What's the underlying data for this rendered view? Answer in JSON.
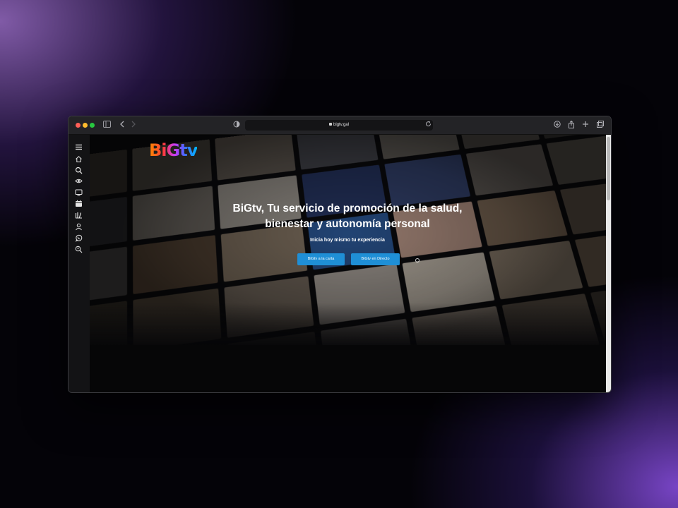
{
  "browser": {
    "url": "bigtv.gal",
    "toolbar_icons": [
      "sidebar-toggle-icon",
      "back-icon",
      "forward-icon",
      "privacy-shield-icon",
      "reload-icon",
      "download-icon",
      "share-icon",
      "new-tab-icon",
      "tabs-overview-icon"
    ]
  },
  "sidebar": {
    "items": [
      {
        "icon": "menu-icon"
      },
      {
        "icon": "home-icon"
      },
      {
        "icon": "search-icon"
      },
      {
        "icon": "eye-icon"
      },
      {
        "icon": "tv-icon"
      },
      {
        "icon": "calendar-icon"
      },
      {
        "icon": "library-icon"
      },
      {
        "icon": "user-icon"
      },
      {
        "icon": "whatsapp-icon"
      },
      {
        "icon": "user-search-icon"
      }
    ]
  },
  "hero": {
    "logo": "BiGtv",
    "title": "BiGtv, Tu servicio de promoción de la salud, bienestar y autonomía personal",
    "subtitle": "Inicia hoy mismo tu experiencia",
    "buttons": [
      {
        "label": "BiGtv a la carta"
      },
      {
        "label": "BiGtv en Directo"
      }
    ]
  },
  "colors": {
    "button_bg": "#1f8fd6",
    "sidebar_bg": "#131315",
    "toolbar_bg": "#232326"
  }
}
